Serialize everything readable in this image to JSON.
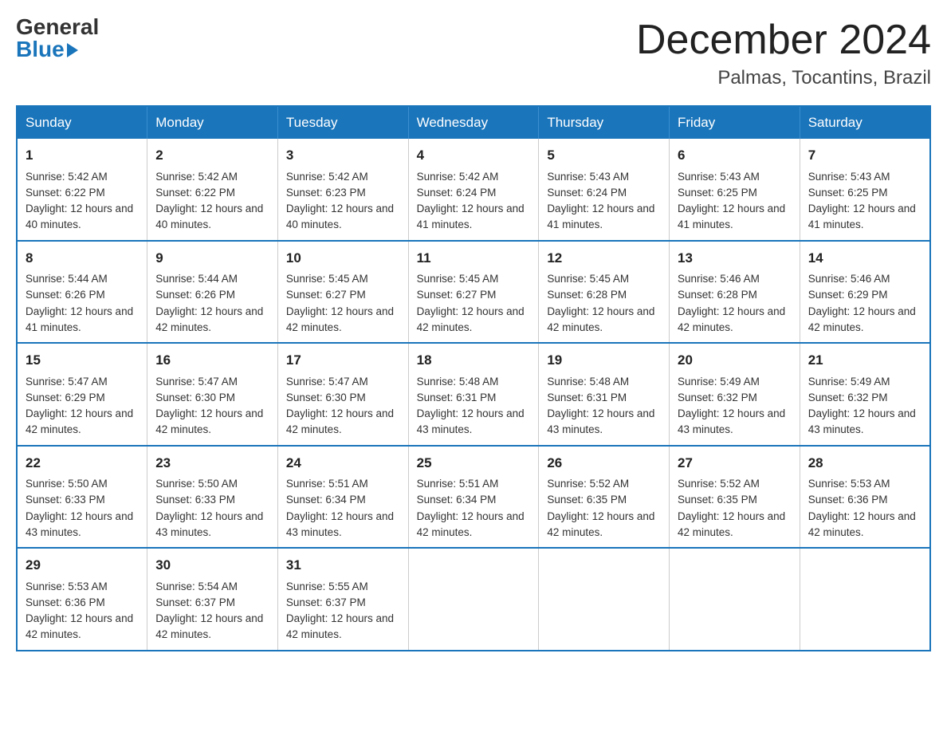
{
  "header": {
    "logo_general": "General",
    "logo_blue": "Blue",
    "month_title": "December 2024",
    "location": "Palmas, Tocantins, Brazil"
  },
  "weekdays": [
    "Sunday",
    "Monday",
    "Tuesday",
    "Wednesday",
    "Thursday",
    "Friday",
    "Saturday"
  ],
  "weeks": [
    [
      {
        "day": "1",
        "sunrise": "Sunrise: 5:42 AM",
        "sunset": "Sunset: 6:22 PM",
        "daylight": "Daylight: 12 hours and 40 minutes."
      },
      {
        "day": "2",
        "sunrise": "Sunrise: 5:42 AM",
        "sunset": "Sunset: 6:22 PM",
        "daylight": "Daylight: 12 hours and 40 minutes."
      },
      {
        "day": "3",
        "sunrise": "Sunrise: 5:42 AM",
        "sunset": "Sunset: 6:23 PM",
        "daylight": "Daylight: 12 hours and 40 minutes."
      },
      {
        "day": "4",
        "sunrise": "Sunrise: 5:42 AM",
        "sunset": "Sunset: 6:24 PM",
        "daylight": "Daylight: 12 hours and 41 minutes."
      },
      {
        "day": "5",
        "sunrise": "Sunrise: 5:43 AM",
        "sunset": "Sunset: 6:24 PM",
        "daylight": "Daylight: 12 hours and 41 minutes."
      },
      {
        "day": "6",
        "sunrise": "Sunrise: 5:43 AM",
        "sunset": "Sunset: 6:25 PM",
        "daylight": "Daylight: 12 hours and 41 minutes."
      },
      {
        "day": "7",
        "sunrise": "Sunrise: 5:43 AM",
        "sunset": "Sunset: 6:25 PM",
        "daylight": "Daylight: 12 hours and 41 minutes."
      }
    ],
    [
      {
        "day": "8",
        "sunrise": "Sunrise: 5:44 AM",
        "sunset": "Sunset: 6:26 PM",
        "daylight": "Daylight: 12 hours and 41 minutes."
      },
      {
        "day": "9",
        "sunrise": "Sunrise: 5:44 AM",
        "sunset": "Sunset: 6:26 PM",
        "daylight": "Daylight: 12 hours and 42 minutes."
      },
      {
        "day": "10",
        "sunrise": "Sunrise: 5:45 AM",
        "sunset": "Sunset: 6:27 PM",
        "daylight": "Daylight: 12 hours and 42 minutes."
      },
      {
        "day": "11",
        "sunrise": "Sunrise: 5:45 AM",
        "sunset": "Sunset: 6:27 PM",
        "daylight": "Daylight: 12 hours and 42 minutes."
      },
      {
        "day": "12",
        "sunrise": "Sunrise: 5:45 AM",
        "sunset": "Sunset: 6:28 PM",
        "daylight": "Daylight: 12 hours and 42 minutes."
      },
      {
        "day": "13",
        "sunrise": "Sunrise: 5:46 AM",
        "sunset": "Sunset: 6:28 PM",
        "daylight": "Daylight: 12 hours and 42 minutes."
      },
      {
        "day": "14",
        "sunrise": "Sunrise: 5:46 AM",
        "sunset": "Sunset: 6:29 PM",
        "daylight": "Daylight: 12 hours and 42 minutes."
      }
    ],
    [
      {
        "day": "15",
        "sunrise": "Sunrise: 5:47 AM",
        "sunset": "Sunset: 6:29 PM",
        "daylight": "Daylight: 12 hours and 42 minutes."
      },
      {
        "day": "16",
        "sunrise": "Sunrise: 5:47 AM",
        "sunset": "Sunset: 6:30 PM",
        "daylight": "Daylight: 12 hours and 42 minutes."
      },
      {
        "day": "17",
        "sunrise": "Sunrise: 5:47 AM",
        "sunset": "Sunset: 6:30 PM",
        "daylight": "Daylight: 12 hours and 42 minutes."
      },
      {
        "day": "18",
        "sunrise": "Sunrise: 5:48 AM",
        "sunset": "Sunset: 6:31 PM",
        "daylight": "Daylight: 12 hours and 43 minutes."
      },
      {
        "day": "19",
        "sunrise": "Sunrise: 5:48 AM",
        "sunset": "Sunset: 6:31 PM",
        "daylight": "Daylight: 12 hours and 43 minutes."
      },
      {
        "day": "20",
        "sunrise": "Sunrise: 5:49 AM",
        "sunset": "Sunset: 6:32 PM",
        "daylight": "Daylight: 12 hours and 43 minutes."
      },
      {
        "day": "21",
        "sunrise": "Sunrise: 5:49 AM",
        "sunset": "Sunset: 6:32 PM",
        "daylight": "Daylight: 12 hours and 43 minutes."
      }
    ],
    [
      {
        "day": "22",
        "sunrise": "Sunrise: 5:50 AM",
        "sunset": "Sunset: 6:33 PM",
        "daylight": "Daylight: 12 hours and 43 minutes."
      },
      {
        "day": "23",
        "sunrise": "Sunrise: 5:50 AM",
        "sunset": "Sunset: 6:33 PM",
        "daylight": "Daylight: 12 hours and 43 minutes."
      },
      {
        "day": "24",
        "sunrise": "Sunrise: 5:51 AM",
        "sunset": "Sunset: 6:34 PM",
        "daylight": "Daylight: 12 hours and 43 minutes."
      },
      {
        "day": "25",
        "sunrise": "Sunrise: 5:51 AM",
        "sunset": "Sunset: 6:34 PM",
        "daylight": "Daylight: 12 hours and 42 minutes."
      },
      {
        "day": "26",
        "sunrise": "Sunrise: 5:52 AM",
        "sunset": "Sunset: 6:35 PM",
        "daylight": "Daylight: 12 hours and 42 minutes."
      },
      {
        "day": "27",
        "sunrise": "Sunrise: 5:52 AM",
        "sunset": "Sunset: 6:35 PM",
        "daylight": "Daylight: 12 hours and 42 minutes."
      },
      {
        "day": "28",
        "sunrise": "Sunrise: 5:53 AM",
        "sunset": "Sunset: 6:36 PM",
        "daylight": "Daylight: 12 hours and 42 minutes."
      }
    ],
    [
      {
        "day": "29",
        "sunrise": "Sunrise: 5:53 AM",
        "sunset": "Sunset: 6:36 PM",
        "daylight": "Daylight: 12 hours and 42 minutes."
      },
      {
        "day": "30",
        "sunrise": "Sunrise: 5:54 AM",
        "sunset": "Sunset: 6:37 PM",
        "daylight": "Daylight: 12 hours and 42 minutes."
      },
      {
        "day": "31",
        "sunrise": "Sunrise: 5:55 AM",
        "sunset": "Sunset: 6:37 PM",
        "daylight": "Daylight: 12 hours and 42 minutes."
      },
      null,
      null,
      null,
      null
    ]
  ]
}
